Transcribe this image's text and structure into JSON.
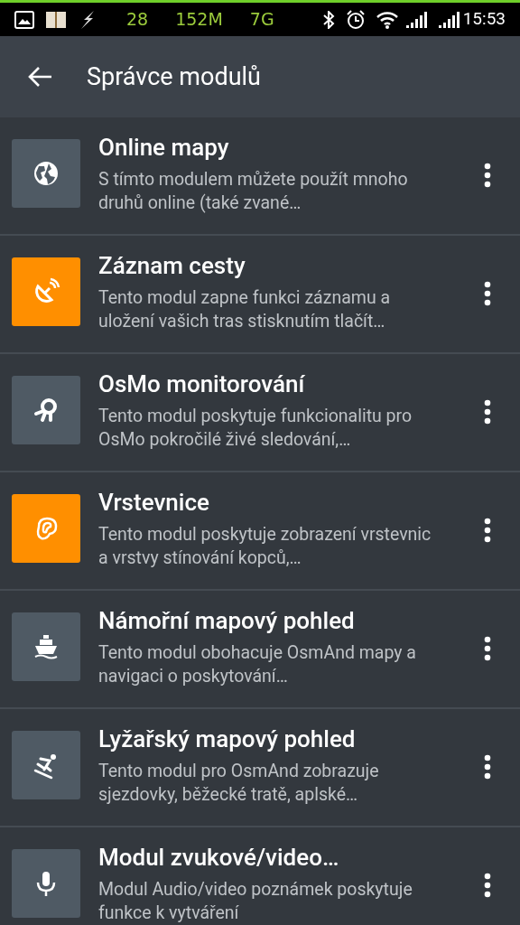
{
  "status_bar": {
    "indicators": [
      "28",
      "152M",
      "7G"
    ],
    "time": "15:53"
  },
  "toolbar": {
    "title": "Správce modulů"
  },
  "modules": [
    {
      "title": "Online mapy",
      "description": "S tímto modulem můžete použít mnoho druhů online (také zvané…",
      "enabled": false
    },
    {
      "title": "Záznam cesty",
      "description": "Tento modul zapne funkci záznamu a uložení vašich tras stisknutím tlačít…",
      "enabled": true
    },
    {
      "title": "OsMo monitorování",
      "description": "Tento modul poskytuje funkcionalitu pro OsMo pokročilé živé sledování,…",
      "enabled": false
    },
    {
      "title": "Vrstevnice",
      "description": "Tento modul poskytuje zobrazení vrstevnic a vrstvy stínování kopců,…",
      "enabled": true
    },
    {
      "title": "Námořní mapový pohled",
      "description": "Tento modul obohacuje OsmAnd mapy a navigaci o poskytování…",
      "enabled": false
    },
    {
      "title": "Lyžařský mapový pohled",
      "description": "Tento modul pro OsmAnd zobrazuje sjezdovky, běžecké tratě, aplské…",
      "enabled": false
    },
    {
      "title": "Modul zvukové/video…",
      "description": "Modul Audio/video poznámek poskytuje funkce k vytváření",
      "enabled": false
    }
  ]
}
